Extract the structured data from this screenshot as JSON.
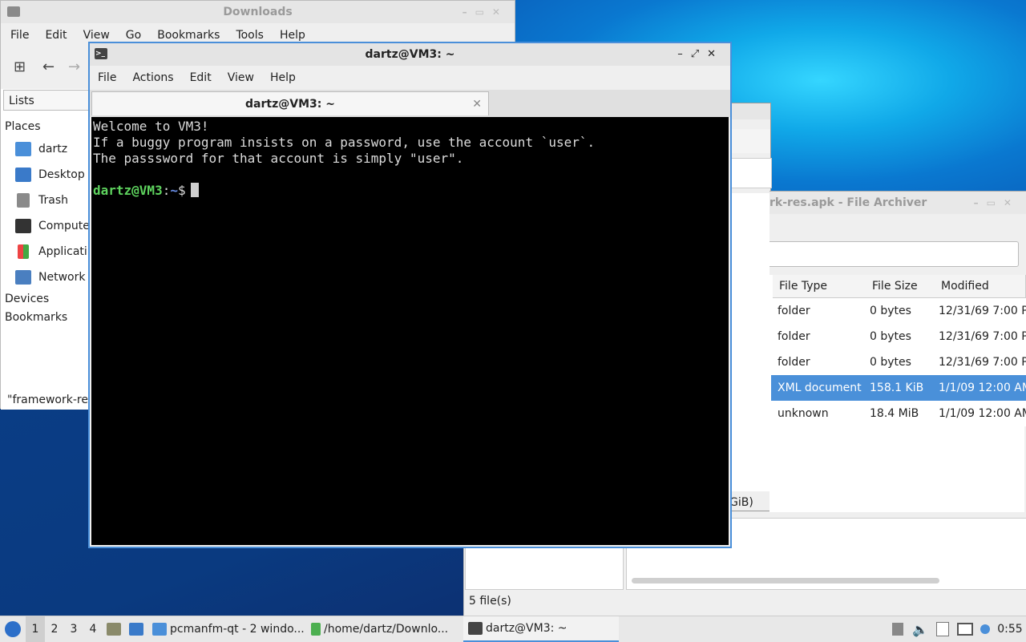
{
  "colors": {
    "accent": "#4a8fd9",
    "selection": "#4a90d9",
    "prompt_user": "#5ed35e",
    "prompt_path": "#6a8fe8"
  },
  "downloads": {
    "title": "Downloads",
    "menu": [
      "File",
      "Edit",
      "View",
      "Go",
      "Bookmarks",
      "Tools",
      "Help"
    ],
    "side_tab": "Lists",
    "places_head": "Places",
    "places": [
      {
        "label": "dartz",
        "icon": "home-folder-icon"
      },
      {
        "label": "Desktop",
        "icon": "desktop-icon"
      },
      {
        "label": "Trash",
        "icon": "trash-icon"
      },
      {
        "label": "Compute",
        "icon": "computer-icon"
      },
      {
        "label": "Applicati",
        "icon": "applications-icon"
      },
      {
        "label": "Network",
        "icon": "network-icon"
      }
    ],
    "devices_head": "Devices",
    "bookmarks_head": "Bookmarks",
    "status": "\"framework-res"
  },
  "archiver": {
    "title": "rk-res.apk - File Archiver",
    "columns": [
      "File Type",
      "File Size",
      "Modified"
    ],
    "rows": [
      {
        "type": "folder",
        "size": "0 bytes",
        "modified": "12/31/69 7:00 P"
      },
      {
        "type": "folder",
        "size": "0 bytes",
        "modified": "12/31/69 7:00 P"
      },
      {
        "type": "folder",
        "size": "0 bytes",
        "modified": "12/31/69 7:00 P"
      },
      {
        "type": "XML document",
        "size": "158.1 KiB",
        "modified": "1/1/09 12:00 AM"
      },
      {
        "type": "unknown",
        "size": "18.4 MiB",
        "modified": "1/1/09 12:00 AM"
      }
    ],
    "selected_row_index": 3,
    "space_text": "GiB)",
    "status": "5 file(s)"
  },
  "terminal": {
    "title": "dartz@VM3: ~",
    "menu": [
      "File",
      "Actions",
      "Edit",
      "View",
      "Help"
    ],
    "tab_label": "dartz@VM3: ~",
    "lines": [
      "Welcome to VM3!",
      "If a buggy program insists on a password, use the account `user`.",
      "The passsword for that account is simply \"user\"."
    ],
    "prompt_user": "dartz@VM3",
    "prompt_sep": ":",
    "prompt_path": "~",
    "prompt_end": "$"
  },
  "taskbar": {
    "workspaces": [
      "1",
      "2",
      "3",
      "4"
    ],
    "active_workspace": "1",
    "tasks": [
      {
        "label": "pcmanfm-qt - 2 windo...",
        "icon": "folder-icon"
      },
      {
        "label": "/home/dartz/Downlo...",
        "icon": "archive-icon"
      },
      {
        "label": "dartz@VM3: ~",
        "icon": "terminal-icon"
      }
    ],
    "clock": "0:55"
  }
}
